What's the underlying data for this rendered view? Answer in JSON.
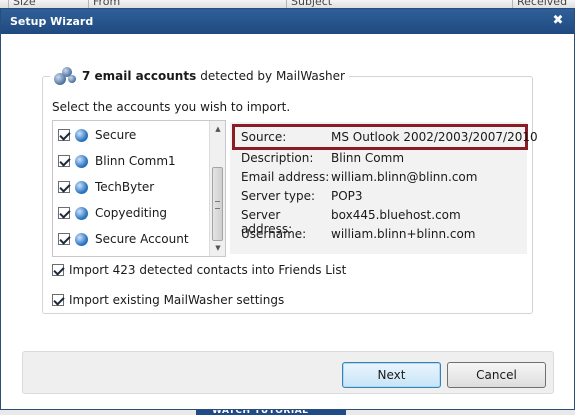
{
  "background": {
    "columns": [
      "Size",
      "From",
      "Subject",
      "Received"
    ],
    "tutorial_label": "WATCH TUTORIAL"
  },
  "dialog": {
    "title": "Setup Wizard",
    "close_glyph": "✖"
  },
  "group": {
    "count_text": "7 email accounts",
    "rest_text": "detected by MailWasher",
    "select_label": "Select the accounts you wish to import."
  },
  "accounts": [
    {
      "label": "Secure",
      "checked": true
    },
    {
      "label": "Blinn Comm1",
      "checked": true
    },
    {
      "label": "TechByter",
      "checked": true
    },
    {
      "label": "Copyediting",
      "checked": true
    },
    {
      "label": "Secure Account",
      "checked": true
    }
  ],
  "details": {
    "source": {
      "label": "Source:",
      "value": "MS Outlook 2002/2003/2007/2010"
    },
    "description": {
      "label": "Description:",
      "value": "Blinn Comm"
    },
    "email": {
      "label": "Email address:",
      "value": "william.blinn@blinn.com"
    },
    "server_type": {
      "label": "Server type:",
      "value": "POP3"
    },
    "server_address": {
      "label": "Server address:",
      "value": "box445.bluehost.com"
    },
    "username": {
      "label": "Username:",
      "value": "william.blinn+blinn.com"
    }
  },
  "options": {
    "import_contacts": "Import 423 detected contacts into Friends List",
    "import_settings": "Import existing MailWasher settings"
  },
  "buttons": {
    "next": "Next",
    "cancel": "Cancel"
  },
  "colors": {
    "titlebar": "#1f4a80",
    "highlight_border": "#8a1c26"
  }
}
